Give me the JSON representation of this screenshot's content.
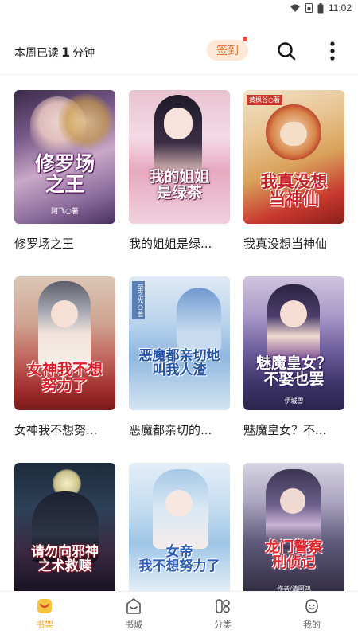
{
  "status_bar": {
    "time": "11:02"
  },
  "header": {
    "reading_prefix": "本周已读",
    "reading_minutes": "1",
    "reading_suffix": "分钟",
    "checkin_label": "签到"
  },
  "books": [
    {
      "title": "修罗场之王",
      "cover_text": "修罗场\n之王",
      "cover_author": "阿飞○著"
    },
    {
      "title": "我的姐姐是绿...",
      "cover_text": "我的姐姐\n是绿茶"
    },
    {
      "title": "我真没想当神仙",
      "cover_text": "我真没想\n当神仙",
      "cover_author": "黄枫谷○著"
    },
    {
      "title": "女神我不想努...",
      "cover_text": "女神我不想\n努力了"
    },
    {
      "title": "恶魔都亲切的...",
      "cover_text": "恶魔都亲切地\n叫我人渣",
      "cover_author": "萤之光○著"
    },
    {
      "title": "魅魔皇女？不...",
      "cover_text": "魅魔皇女？\n不娶也罢",
      "cover_author": "伊城雪"
    },
    {
      "title": "",
      "cover_text": "请勿向邪神\n之术救赎"
    },
    {
      "title": "",
      "cover_text": "女帝\n我不想努力了"
    },
    {
      "title": "",
      "cover_text": "龙门警察\n刑侦记",
      "cover_author": "作者/清阿鸿"
    }
  ],
  "tabs": [
    {
      "label": "书架",
      "icon": "bookshelf-icon",
      "active": true
    },
    {
      "label": "书城",
      "icon": "store-icon",
      "active": false
    },
    {
      "label": "分类",
      "icon": "category-icon",
      "active": false
    },
    {
      "label": "我的",
      "icon": "profile-icon",
      "active": false
    }
  ],
  "colors": {
    "accent": "#f5a623",
    "checkin_bg": "#fde8d8",
    "checkin_text": "#e46f2f",
    "badge": "#f04a3a"
  }
}
